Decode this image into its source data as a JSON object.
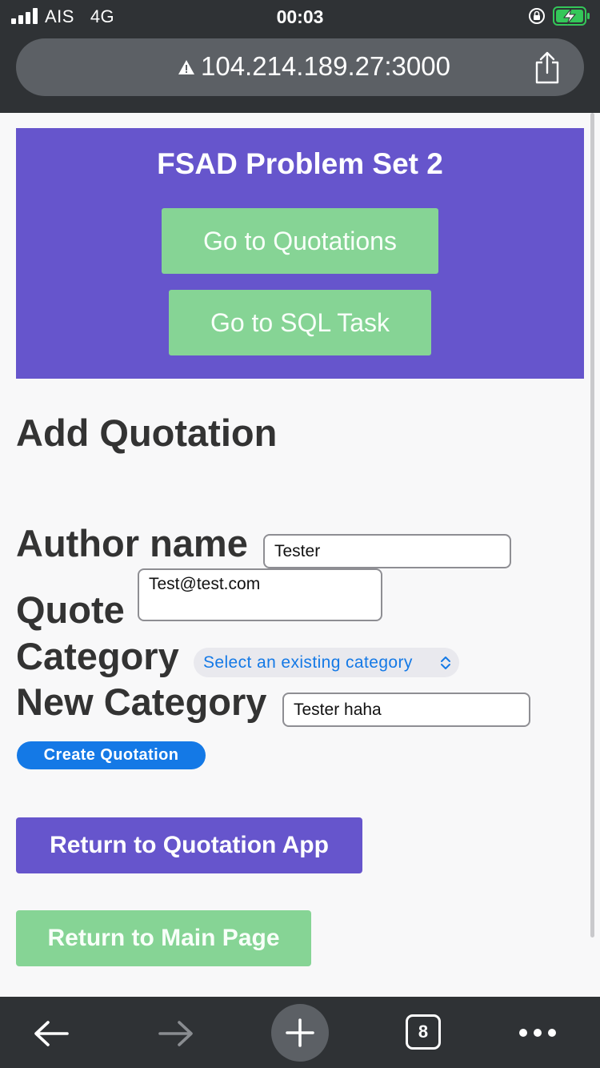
{
  "status_bar": {
    "carrier": "AIS",
    "network": "4G",
    "time": "00:03"
  },
  "browser": {
    "url": "104.214.189.27:3000",
    "tab_count": "8"
  },
  "header": {
    "title": "FSAD Problem Set 2",
    "buttons": [
      {
        "label": "Go to Quotations"
      },
      {
        "label": "Go to SQL Task"
      }
    ]
  },
  "form": {
    "title": "Add Quotation",
    "author_label": "Author name",
    "author_value": "Tester",
    "quote_label": "Quote",
    "quote_value": "Test@test.com",
    "category_label": "Category",
    "category_selected": "Select an existing category",
    "new_category_label": "New Category",
    "new_category_value": "Tester haha",
    "submit_label": "Create Quotation"
  },
  "nav": {
    "return_app_label": "Return to Quotation App",
    "return_main_label": "Return to Main Page"
  },
  "colors": {
    "header_bg": "#6655cc",
    "green_button": "#86d495",
    "blue_button": "#1479e6",
    "chrome_bg": "#2f3235"
  },
  "icons": [
    "warning-icon",
    "share-icon",
    "back-arrow-icon",
    "forward-arrow-icon",
    "plus-icon",
    "tabs-icon",
    "more-icon",
    "orientation-lock-icon",
    "battery-icon",
    "signal-icon",
    "chevron-updown-icon"
  ]
}
